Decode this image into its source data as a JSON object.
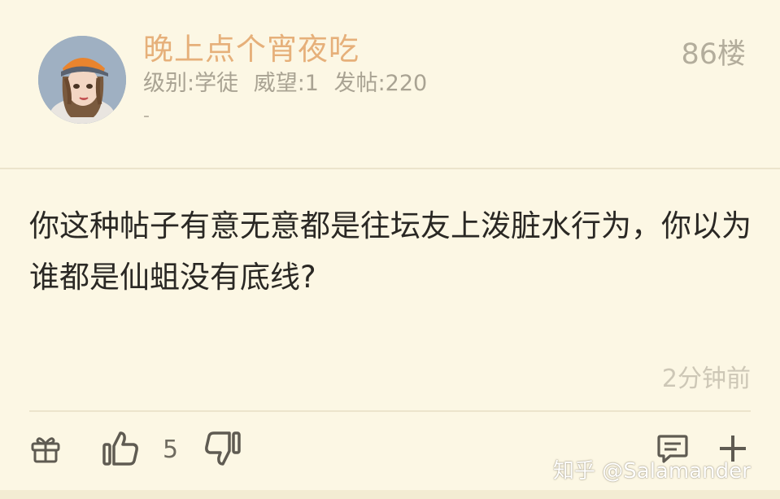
{
  "post": {
    "username": "晚上点个宵夜吃",
    "level": "级别:学徒",
    "reputation": "威望:1",
    "post_count": "发帖:220",
    "signature": "-",
    "floor": "86楼",
    "content": "你这种帖子有意无意都是往坛友上泼脏水行为，你以为谁都是仙蛆没有底线?",
    "timestamp": "2分钟前",
    "like_count": "5"
  },
  "icons": {
    "gift": "gift-icon",
    "like": "thumbs-up-icon",
    "dislike": "thumbs-down-icon",
    "comment": "comment-icon",
    "more": "plus-icon"
  },
  "watermark": "知乎 @Salamander",
  "colors": {
    "background": "#fcf7e4",
    "username": "#e6b07a",
    "meta": "#a9a393",
    "content_text": "#2a2824",
    "timestamp": "#cdc7b6",
    "icon": "#5f5b52"
  }
}
